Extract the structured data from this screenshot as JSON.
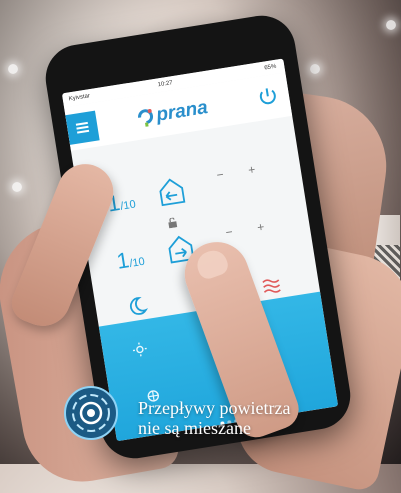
{
  "status_bar": {
    "carrier": "Kyivstar",
    "time": "10:27",
    "battery": "65%"
  },
  "app": {
    "brand": "prana"
  },
  "controls": [
    {
      "speed": "1",
      "max": "/10",
      "minus": "−",
      "plus": "+",
      "icon": "fan-intake-icon"
    },
    {
      "speed": "1",
      "max": "/10",
      "minus": "−",
      "plus": "+",
      "icon": "fan-exhaust-icon"
    }
  ],
  "modes": [
    "night-mode-icon",
    "auto-mode-icon",
    "heater-icon"
  ],
  "colors": {
    "accent": "#1e9fd8",
    "panel": "#2bb1e3",
    "heater": "#e05a5a"
  },
  "caption": {
    "line1": "Przepływy powietrza",
    "line2": "nie są mieszane"
  }
}
